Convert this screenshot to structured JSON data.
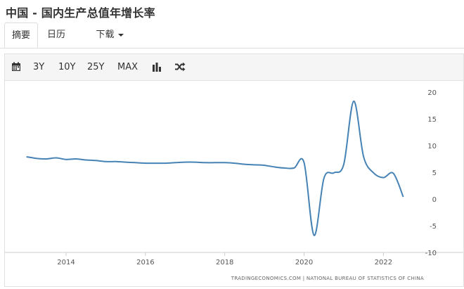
{
  "page": {
    "title": "中国 - 国内生产总值年增长率"
  },
  "tabs": [
    {
      "label": "摘要",
      "active": true
    },
    {
      "label": "日历",
      "active": false
    },
    {
      "label": "下载",
      "active": false
    }
  ],
  "toolbar": {
    "calendar_icon": "calendar-icon",
    "ranges": [
      "3Y",
      "10Y",
      "25Y",
      "MAX"
    ],
    "bar_icon": "bar-chart-icon",
    "shuffle_icon": "shuffle-icon"
  },
  "chart_data": {
    "type": "line",
    "source": "TRADINGECONOMICS.COM  |  NATIONAL BUREAU OF STATISTICS OF CHINA",
    "line_color": "#4682b4",
    "xlim": [
      2012.6,
      2022.95
    ],
    "ylim": [
      -10,
      20
    ],
    "x_ticks": [
      2014,
      2016,
      2018,
      2020,
      2022
    ],
    "y_ticks": [
      -10,
      -5,
      0,
      5,
      10,
      15,
      20
    ],
    "grid": false,
    "series": [
      {
        "x": [
          2013.0,
          2013.25,
          2013.5,
          2013.75,
          2014.0,
          2014.25,
          2014.5,
          2014.75,
          2015.0,
          2015.25,
          2015.5,
          2015.75,
          2016.0,
          2016.25,
          2016.5,
          2016.75,
          2017.0,
          2017.25,
          2017.5,
          2017.75,
          2018.0,
          2018.25,
          2018.5,
          2018.75,
          2019.0,
          2019.25,
          2019.5,
          2019.75,
          2020.0,
          2020.25,
          2020.5,
          2020.75,
          2021.0,
          2021.25,
          2021.5,
          2021.75,
          2022.0,
          2022.25,
          2022.5
        ],
        "y": [
          7.9,
          7.6,
          7.5,
          7.7,
          7.4,
          7.5,
          7.3,
          7.2,
          7.0,
          7.0,
          6.9,
          6.8,
          6.7,
          6.7,
          6.7,
          6.8,
          6.9,
          6.9,
          6.8,
          6.8,
          6.8,
          6.7,
          6.5,
          6.4,
          6.3,
          6.0,
          5.8,
          5.8,
          6.8,
          -6.8,
          3.9,
          4.9,
          6.5,
          18.3,
          7.9,
          4.9,
          4.0,
          4.8,
          0.4
        ]
      }
    ]
  }
}
